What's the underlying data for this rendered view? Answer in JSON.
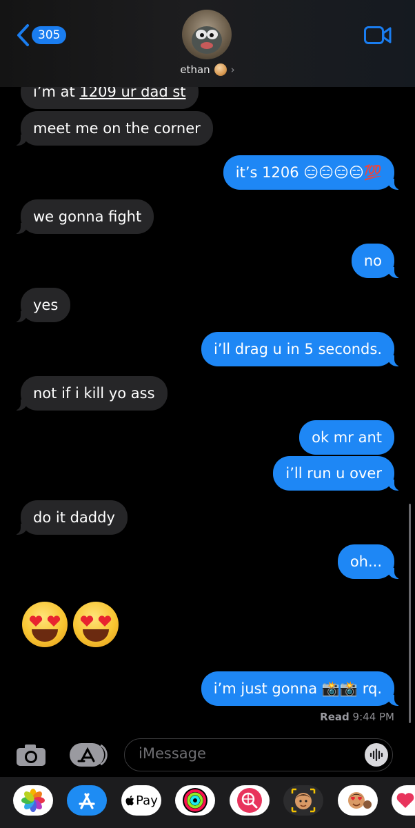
{
  "header": {
    "back_count": "305",
    "contact_name": "ethan"
  },
  "messages": [
    {
      "id": "m1",
      "dir": "in",
      "parts": [
        {
          "text": "i’m at "
        },
        {
          "text": "1209 ur dad st",
          "underline": true
        }
      ]
    },
    {
      "id": "m2",
      "dir": "in",
      "text": "meet me on the corner"
    },
    {
      "id": "m3",
      "dir": "out",
      "text": "it’s 1206 😑😑😑😑💯"
    },
    {
      "id": "m4",
      "dir": "in",
      "text": "we gonna fight"
    },
    {
      "id": "m5",
      "dir": "out",
      "text": "no"
    },
    {
      "id": "m6",
      "dir": "in",
      "text": "yes"
    },
    {
      "id": "m7",
      "dir": "out",
      "text": "i’ll drag u in 5 seconds."
    },
    {
      "id": "m8",
      "dir": "in",
      "text": "not if i kill yo ass"
    },
    {
      "id": "m9",
      "dir": "out",
      "text": "ok mr ant"
    },
    {
      "id": "m10",
      "dir": "out",
      "text": "i’ll run u over"
    },
    {
      "id": "m11",
      "dir": "in",
      "text": "do it daddy"
    },
    {
      "id": "m12",
      "dir": "out",
      "text": "oh..."
    },
    {
      "id": "m13",
      "dir": "in",
      "emoji": [
        "heart-eyes-emoji",
        "heart-eyes-emoji"
      ]
    },
    {
      "id": "m14",
      "dir": "out",
      "text": "i’m just gonna 📸📸 rq."
    }
  ],
  "read_receipt": {
    "label": "Read",
    "time": "9:44 PM"
  },
  "composer": {
    "placeholder": "iMessage"
  },
  "app_strip": {
    "items": [
      "photos-app",
      "app-store-app",
      "apple-pay-app",
      "activity-app",
      "search-images-app",
      "memoji-app",
      "animoji-stickers-app",
      "digital-touch-app"
    ],
    "apple_pay_label": "Pay"
  },
  "colors": {
    "outgoing": "#1e87f5",
    "incoming": "#262628",
    "accent": "#1a7df0"
  }
}
